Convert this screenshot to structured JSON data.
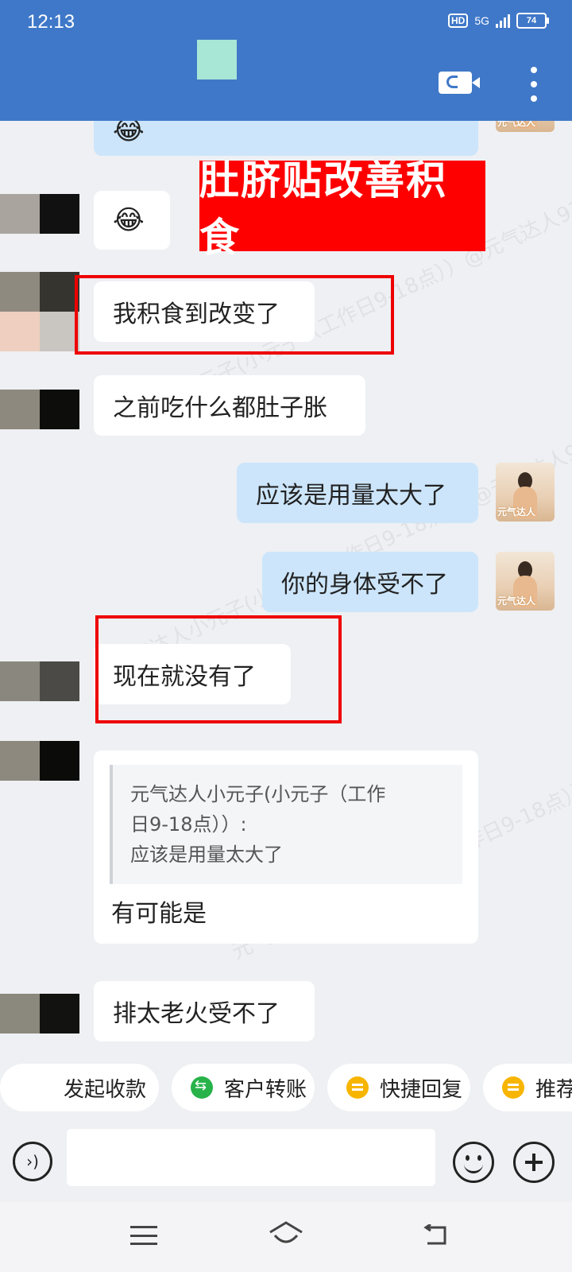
{
  "status_bar": {
    "time": "12:13",
    "hd": "HD",
    "network": "5G",
    "battery": "74"
  },
  "chat": {
    "messages": [
      {
        "side": "left",
        "text": "😂"
      },
      {
        "side": "left",
        "text": "我积食到改变了"
      },
      {
        "side": "left",
        "text": "之前吃什么都肚子胀"
      },
      {
        "side": "right",
        "text": "应该是用量太大了"
      },
      {
        "side": "right",
        "text": "你的身体受不了"
      },
      {
        "side": "left",
        "text": "现在就没有了"
      },
      {
        "side": "left",
        "text": "排太老火受不了"
      }
    ],
    "top_partial_message": "😂",
    "quote": {
      "author_line1": "元气达人小元子(小元子（工作",
      "author_line2": "日9-18点））:",
      "quoted_text": "应该是用量太大了",
      "reply": "有可能是"
    },
    "banner": "肚脐贴改善积食",
    "self_avatar_tag": "元气达人",
    "watermark": "元气达人小元子(小元子（工作日9-18点））@元气达人9371"
  },
  "quick_actions": [
    {
      "label": "发起收款",
      "icon": ""
    },
    {
      "label": "客户转账",
      "icon": "transfer-icon"
    },
    {
      "label": "快捷回复",
      "icon": "quick-reply-icon"
    },
    {
      "label": "推荐-",
      "icon": "recommend-icon"
    }
  ],
  "input": {
    "placeholder": ""
  },
  "colors": {
    "title_bar": "#3f78c8",
    "self_bubble": "#cce5fb",
    "banner": "#ff0000",
    "highlight_box": "#e00000"
  }
}
